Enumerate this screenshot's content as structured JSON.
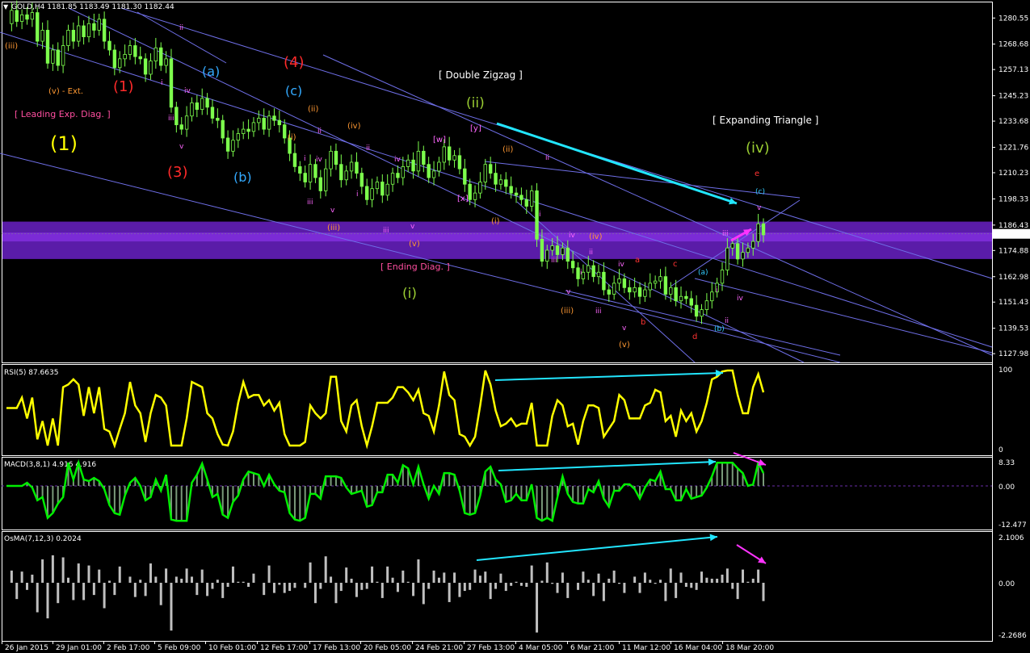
{
  "chart_data": [
    {
      "type": "candlestick",
      "header": "GOLD,H4  1181.85 1183.49 1181.30 1182.44",
      "current_price_label": "1182.44",
      "y_axis_ticks": [
        "1280.55",
        "1268.68",
        "1257.13",
        "1245.23",
        "1233.68",
        "1221.76",
        "1210.23",
        "1198.33",
        "1186.43",
        "1174.88",
        "1162.98",
        "1151.43",
        "1139.53",
        "1127.98"
      ],
      "x_axis_ticks": [
        "26 Jan 2015",
        "29 Jan 01:00",
        "2 Feb 17:00",
        "5 Feb 09:00",
        "10 Feb 01:00",
        "12 Feb 17:00",
        "17 Feb 13:00",
        "20 Feb 05:00",
        "24 Feb 21:00",
        "27 Feb 13:00",
        "4 Mar 05:00",
        "6 Mar 21:00",
        "11 Mar 12:00",
        "16 Mar 04:00",
        "18 Mar 20:00"
      ],
      "ylim": [
        1124,
        1288
      ],
      "price_path": [
        1278,
        1284,
        1279,
        1282,
        1280,
        1283,
        1270,
        1275,
        1260,
        1266,
        1259,
        1268,
        1275,
        1270,
        1277,
        1272,
        1278,
        1275,
        1280,
        1270,
        1266,
        1258,
        1262,
        1264,
        1268,
        1263,
        1262,
        1255,
        1261,
        1267,
        1259,
        1262,
        1240,
        1232,
        1230,
        1236,
        1242,
        1239,
        1244,
        1240,
        1235,
        1234,
        1226,
        1220,
        1225,
        1228,
        1230,
        1229,
        1233,
        1235,
        1230,
        1236,
        1234,
        1232,
        1226,
        1219,
        1213,
        1210,
        1206,
        1214,
        1208,
        1202,
        1212,
        1220,
        1214,
        1207,
        1211,
        1215,
        1210,
        1204,
        1198,
        1203,
        1206,
        1200,
        1205,
        1210,
        1208,
        1213,
        1216,
        1211,
        1220,
        1214,
        1208,
        1211,
        1215,
        1222,
        1216,
        1218,
        1212,
        1205,
        1198,
        1201,
        1206,
        1214,
        1210,
        1205,
        1207,
        1204,
        1201,
        1200,
        1198,
        1195,
        1202,
        1180,
        1170,
        1175,
        1177,
        1173,
        1176,
        1170,
        1167,
        1162,
        1165,
        1168,
        1163,
        1165,
        1157,
        1155,
        1160,
        1162,
        1158,
        1156,
        1158,
        1154,
        1157,
        1160,
        1161,
        1163,
        1155,
        1158,
        1152,
        1154,
        1153,
        1150,
        1145,
        1148,
        1152,
        1156,
        1160,
        1166,
        1176,
        1178,
        1171,
        1174,
        1176,
        1179,
        1187,
        1182
      ],
      "wave_labels": [
        {
          "text": "(1)",
          "color": "#ffff00"
        },
        {
          "text": "(iii)",
          "color": "#ff9933"
        },
        {
          "text": "(v) - Ext.",
          "color": "#ff9933"
        },
        {
          "text": "[ Leading Exp. Diag. ]",
          "color": "#ff4fa0"
        },
        {
          "text": "(1)",
          "color": "#ff2a2a"
        },
        {
          "text": "(3)",
          "color": "#ff2a2a"
        },
        {
          "text": "(4)",
          "color": "#ff2a2a"
        },
        {
          "text": "(a)",
          "color": "#33aaff"
        },
        {
          "text": "(b)",
          "color": "#33aaff"
        },
        {
          "text": "(c)",
          "color": "#33aaff"
        },
        {
          "text": "[ Double Zigzag ]",
          "color": "#ffffff"
        },
        {
          "text": "(ii)",
          "color": "#9acd32"
        },
        {
          "text": "[ Ending Diag. ]",
          "color": "#ff4fa0"
        },
        {
          "text": "(i)",
          "color": "#9acd32"
        },
        {
          "text": "[ Expanding Triangle ]",
          "color": "#ffffff"
        },
        {
          "text": "(iv)",
          "color": "#9acd32"
        },
        {
          "text": "[y]",
          "color": "#ff66ff"
        },
        {
          "text": "[w]",
          "color": "#ff66ff"
        },
        {
          "text": "[x]",
          "color": "#ff66ff"
        },
        {
          "text": "(ii)",
          "color": "#ff9933"
        },
        {
          "text": "(iv)",
          "color": "#ff9933"
        },
        {
          "text": "(i)",
          "color": "#ff9933"
        },
        {
          "text": "(iii)",
          "color": "#ff9933"
        },
        {
          "text": "(v)",
          "color": "#ff9933"
        },
        {
          "text": "(ii)",
          "color": "#ff9933"
        },
        {
          "text": "(i)",
          "color": "#ff9933"
        },
        {
          "text": "(iv)",
          "color": "#ff9933"
        },
        {
          "text": "(iii)",
          "color": "#ff9933"
        },
        {
          "text": "(v)",
          "color": "#ff9933"
        },
        {
          "text": "e",
          "color": "#ff3333"
        },
        {
          "text": "(c)",
          "color": "#33ccff"
        },
        {
          "text": "v",
          "color": "#ff66ff"
        },
        {
          "text": "a",
          "color": "#ff3333"
        },
        {
          "text": "b",
          "color": "#ff3333"
        },
        {
          "text": "c",
          "color": "#ff3333"
        },
        {
          "text": "d",
          "color": "#ff3333"
        },
        {
          "text": "(a)",
          "color": "#33ccff"
        },
        {
          "text": "(b)",
          "color": "#33ccff"
        },
        {
          "text": "iii",
          "color": "#ff66ff"
        },
        {
          "text": "iv",
          "color": "#ff66ff"
        },
        {
          "text": "i",
          "color": "#ff66ff"
        },
        {
          "text": "ii",
          "color": "#ff66ff"
        }
      ]
    },
    {
      "type": "line",
      "header": "RSI(5) 87.6635",
      "ylim": [
        0,
        100
      ],
      "y_axis_ticks": [
        "100",
        "0"
      ],
      "color": "#ffff00"
    },
    {
      "type": "bar",
      "header": "MACD(3,8,1) 4.916 4.916",
      "ylim": [
        -12.477,
        8.33
      ],
      "y_axis_ticks": [
        "8.33",
        "0.00",
        "-12.477"
      ],
      "color": "#00ee00"
    },
    {
      "type": "bar",
      "header": "OsMA(7,12,3) 0.2024",
      "ylim": [
        -2.2686,
        2.1006
      ],
      "y_axis_ticks": [
        "2.1006",
        "0.00",
        "-2.2686"
      ],
      "color": "#c0c0c0"
    }
  ]
}
